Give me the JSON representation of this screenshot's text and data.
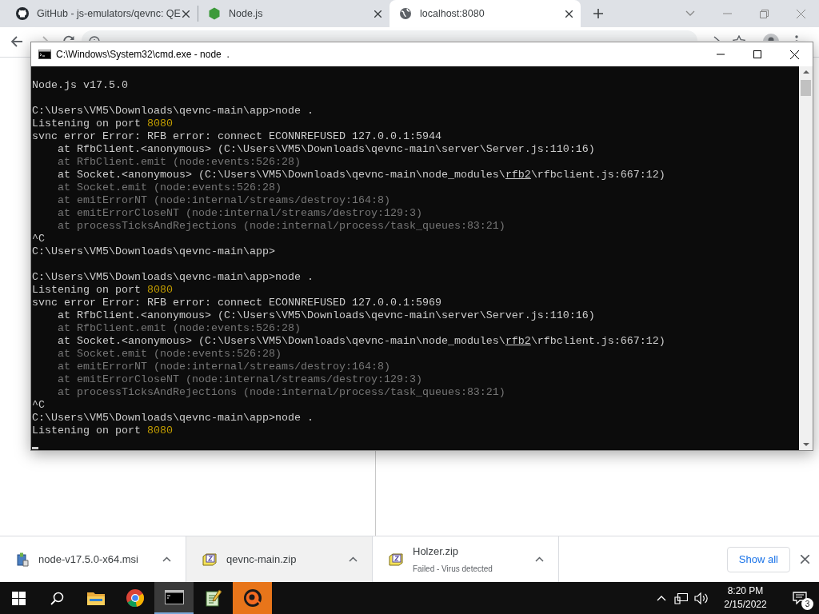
{
  "browser": {
    "tabs": [
      {
        "title": "GitHub - js-emulators/qevnc: QE",
        "selected": false
      },
      {
        "title": "Node.js",
        "selected": false
      },
      {
        "title": "localhost:8080",
        "selected": true
      }
    ]
  },
  "terminal": {
    "title": "C:\\Windows\\System32\\cmd.exe - node  .",
    "blocks": [
      [
        {
          "text": "Node.js v17.5.0",
          "dim": false
        }
      ],
      [
        {
          "text": "C:\\Users\\VM5\\Downloads\\qevnc-main\\app>node .",
          "dim": false
        },
        {
          "dim": false,
          "parts": [
            {
              "text": "Listening on port ",
              "highlighted": false
            },
            {
              "text": "8080",
              "highlighted": true
            }
          ]
        },
        {
          "text": "svnc error Error: RFB error: connect ECONNREFUSED 127.0.0.1:5944",
          "dim": false
        },
        {
          "text": "    at RfbClient.<anonymous> (C:\\Users\\VM5\\Downloads\\qevnc-main\\server\\Server.js:110:16)",
          "dim": false
        },
        {
          "text": "    at RfbClient.emit (node:events:526:28)",
          "dim": true
        },
        {
          "dim": false,
          "parts": [
            {
              "text": "    at Socket.<anonymous> (C:\\Users\\VM5\\Downloads\\qevnc-main\\node_modules\\",
              "underlined": false
            },
            {
              "text": "rfb2",
              "underlined": true
            },
            {
              "text": "\\rfbclient.js:667:12)",
              "underlined": false
            }
          ]
        },
        {
          "text": "    at Socket.emit (node:events:526:28)",
          "dim": true
        },
        {
          "text": "    at emitErrorNT (node:internal/streams/destroy:164:8)",
          "dim": true
        },
        {
          "text": "    at emitErrorCloseNT (node:internal/streams/destroy:129:3)",
          "dim": true
        },
        {
          "text": "    at processTicksAndRejections (node:internal/process/task_queues:83:21)",
          "dim": true
        },
        {
          "text": "^C",
          "dim": false
        },
        {
          "text": "C:\\Users\\VM5\\Downloads\\qevnc-main\\app>",
          "dim": false
        }
      ],
      [
        {
          "text": "C:\\Users\\VM5\\Downloads\\qevnc-main\\app>node .",
          "dim": false
        },
        {
          "dim": false,
          "parts": [
            {
              "text": "Listening on port ",
              "highlighted": false
            },
            {
              "text": "8080",
              "highlighted": true
            }
          ]
        },
        {
          "text": "svnc error Error: RFB error: connect ECONNREFUSED 127.0.0.1:5969",
          "dim": false
        },
        {
          "text": "    at RfbClient.<anonymous> (C:\\Users\\VM5\\Downloads\\qevnc-main\\server\\Server.js:110:16)",
          "dim": false
        },
        {
          "text": "    at RfbClient.emit (node:events:526:28)",
          "dim": true
        },
        {
          "dim": false,
          "parts": [
            {
              "text": "    at Socket.<anonymous> (C:\\Users\\VM5\\Downloads\\qevnc-main\\node_modules\\",
              "underlined": false
            },
            {
              "text": "rfb2",
              "underlined": true
            },
            {
              "text": "\\rfbclient.js:667:12)",
              "underlined": false
            }
          ]
        },
        {
          "text": "    at Socket.emit (node:events:526:28)",
          "dim": true
        },
        {
          "text": "    at emitErrorNT (node:internal/streams/destroy:164:8)",
          "dim": true
        },
        {
          "text": "    at emitErrorCloseNT (node:internal/streams/destroy:129:3)",
          "dim": true
        },
        {
          "text": "    at processTicksAndRejections (node:internal/process/task_queues:83:21)",
          "dim": true
        },
        {
          "text": "^C",
          "dim": false
        },
        {
          "text": "C:\\Users\\VM5\\Downloads\\qevnc-main\\app>node .",
          "dim": false
        },
        {
          "dim": false,
          "parts": [
            {
              "text": "Listening on port ",
              "highlighted": false
            },
            {
              "text": "8080",
              "highlighted": true
            }
          ]
        }
      ]
    ],
    "cursor": true
  },
  "downloads": {
    "items": [
      {
        "name": "node-v17.5.0-x64.msi",
        "highlighted": false
      },
      {
        "name": "qevnc-main.zip",
        "highlighted": true
      },
      {
        "name": "Holzer.zip",
        "status": "Failed - Virus detected",
        "highlighted": false
      }
    ],
    "show_all": "Show all"
  },
  "taskbar": {
    "apps": [
      {
        "active": false,
        "flashing": false
      },
      {
        "active": false,
        "flashing": false
      },
      {
        "active": true,
        "flashing": false
      },
      {
        "active": false,
        "flashing": false
      },
      {
        "active": false,
        "flashing": true
      }
    ],
    "time": "8:20 PM",
    "date": "2/15/2022",
    "notifications": "3"
  }
}
